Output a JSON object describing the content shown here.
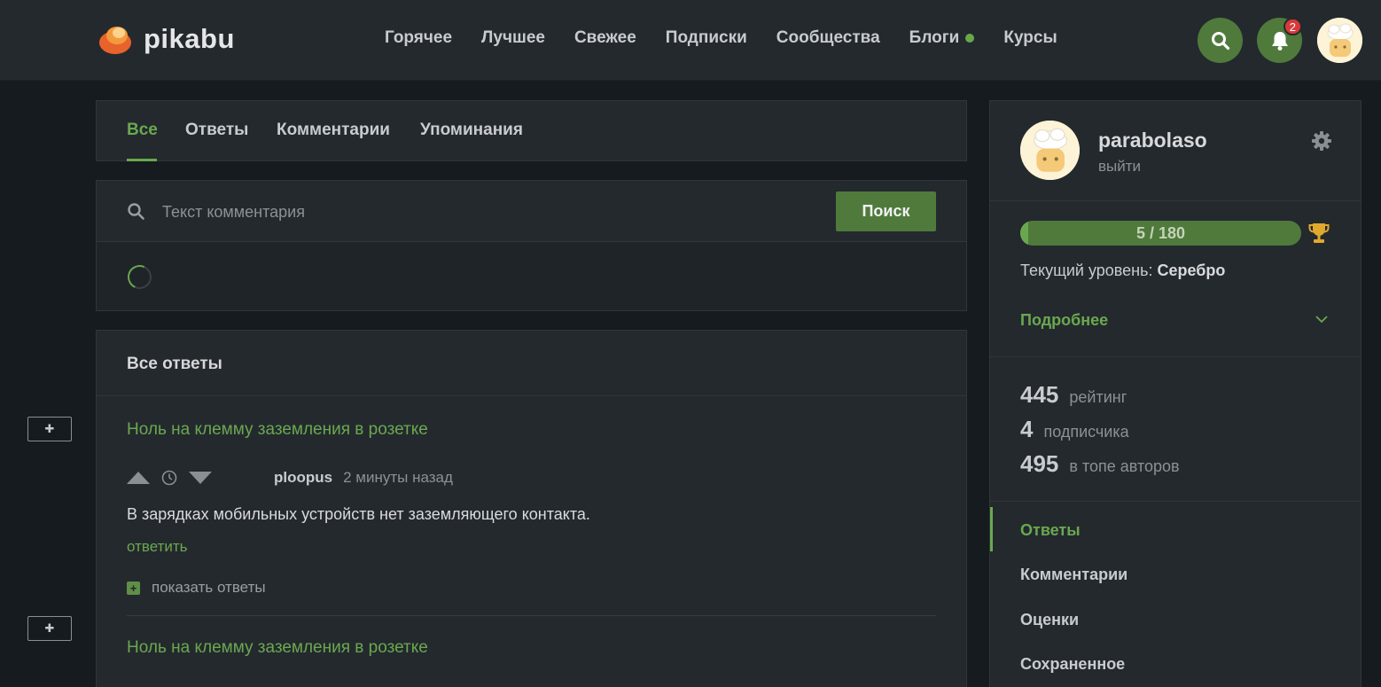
{
  "header": {
    "logo_text": "pikabu",
    "nav": [
      {
        "label": "Горячее"
      },
      {
        "label": "Лучшее"
      },
      {
        "label": "Свежее"
      },
      {
        "label": "Подписки"
      },
      {
        "label": "Сообщества"
      },
      {
        "label": "Блоги",
        "dot": true
      },
      {
        "label": "Курсы"
      }
    ],
    "notification_count": "2",
    "accent_color": "#4f7a3c"
  },
  "tabs": [
    {
      "label": "Все",
      "active": true
    },
    {
      "label": "Ответы"
    },
    {
      "label": "Комментарии"
    },
    {
      "label": "Упоминания"
    }
  ],
  "search": {
    "placeholder": "Текст комментария",
    "value": "",
    "button_label": "Поиск"
  },
  "answers": {
    "title": "Все ответы",
    "items": [
      {
        "post_title": "Ноль на клемму заземления в розетке",
        "author": "ploopus",
        "time": "2 минуты назад",
        "text": "В зарядках мобильных устройств нет заземляющего контакта.",
        "reply_label": "ответить",
        "show_replies_label": "показать ответы"
      },
      {
        "post_title": "Ноль на клемму заземления в розетке"
      }
    ]
  },
  "profile": {
    "username": "parabolaso",
    "logout_label": "выйти",
    "progress_text": "5 / 180",
    "progress_fraction": 0.028,
    "level_prefix": "Текущий уровень:",
    "level_name": "Серебро",
    "more_label": "Подробнее",
    "stats": [
      {
        "value": "445",
        "label": "рейтинг"
      },
      {
        "value": "4",
        "label": "подписчика"
      },
      {
        "value": "495",
        "label": "в топе авторов"
      }
    ],
    "menu": [
      {
        "label": "Ответы",
        "active": true
      },
      {
        "label": "Комментарии"
      },
      {
        "label": "Оценки"
      },
      {
        "label": "Сохраненное"
      }
    ]
  },
  "icons": {
    "search": "search-icon",
    "bell": "bell-icon",
    "gear": "gear-icon",
    "trophy": "trophy-icon",
    "chevron": "chevron-down-icon",
    "clock": "clock-icon"
  }
}
